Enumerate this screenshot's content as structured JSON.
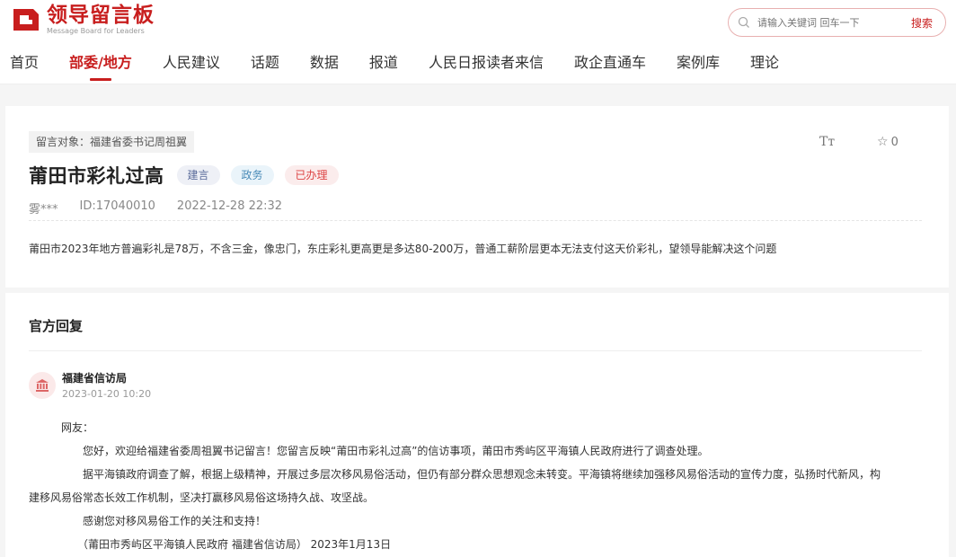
{
  "logo": {
    "title_cn": "领导留言板",
    "title_en": "Message Board for Leaders"
  },
  "search": {
    "placeholder": "请输入关键词 回车一下",
    "button_label": "搜索"
  },
  "nav": [
    {
      "label": "首页"
    },
    {
      "label": "部委/地方",
      "active": true
    },
    {
      "label": "人民建议"
    },
    {
      "label": "话题"
    },
    {
      "label": "数据"
    },
    {
      "label": "报道"
    },
    {
      "label": "人民日报读者来信"
    },
    {
      "label": "政企直通车"
    },
    {
      "label": "案例库"
    },
    {
      "label": "理论"
    }
  ],
  "message": {
    "target": "留言对象：福建省委书记周祖翼",
    "font_toggle": "Tт",
    "fav_count": "0",
    "title": "莆田市彩礼过高",
    "badges": [
      "建言",
      "政务",
      "已办理"
    ],
    "author": "雾***",
    "id": "ID:17040010",
    "time": "2022-12-28 22:32",
    "content": "莆田市2023年地方普遍彩礼是78万，不含三金，像忠门，东庄彩礼更高更是多达80-200万，普通工薪阶层更本无法支付这天价彩礼，望领导能解决这个问题"
  },
  "reply": {
    "section_title": "官方回复",
    "org": "福建省信访局",
    "time": "2023-01-20 10:20",
    "greeting": "网友：",
    "para1": "您好，欢迎给福建省委周祖翼书记留言！您留言反映“莆田市彩礼过高”的信访事项，莆田市秀屿区平海镇人民政府进行了调查处理。",
    "para2_line1": "据平海镇政府调查了解，根据上级精神，开展过多层次移风易俗活动，但仍有部分群众思想观念未转变。平海镇将继续加强移风易俗活动的宣传力度，弘扬时代新风，构",
    "para2_line2": "建移风易俗常态长效工作机制，坚决打赢移风易俗这场持久战、攻坚战。",
    "para3": "感谢您对移风易俗工作的关注和支持！",
    "signature": "（莆田市秀屿区平海镇人民政府  福建省信访局）  2023年1月13日"
  },
  "colors": {
    "brand": "#c81e1e",
    "background": "#f5f5f5"
  },
  "icons": [
    "logo-mark-icon",
    "search-icon",
    "font-size-icon",
    "star-icon",
    "government-building-icon"
  ]
}
